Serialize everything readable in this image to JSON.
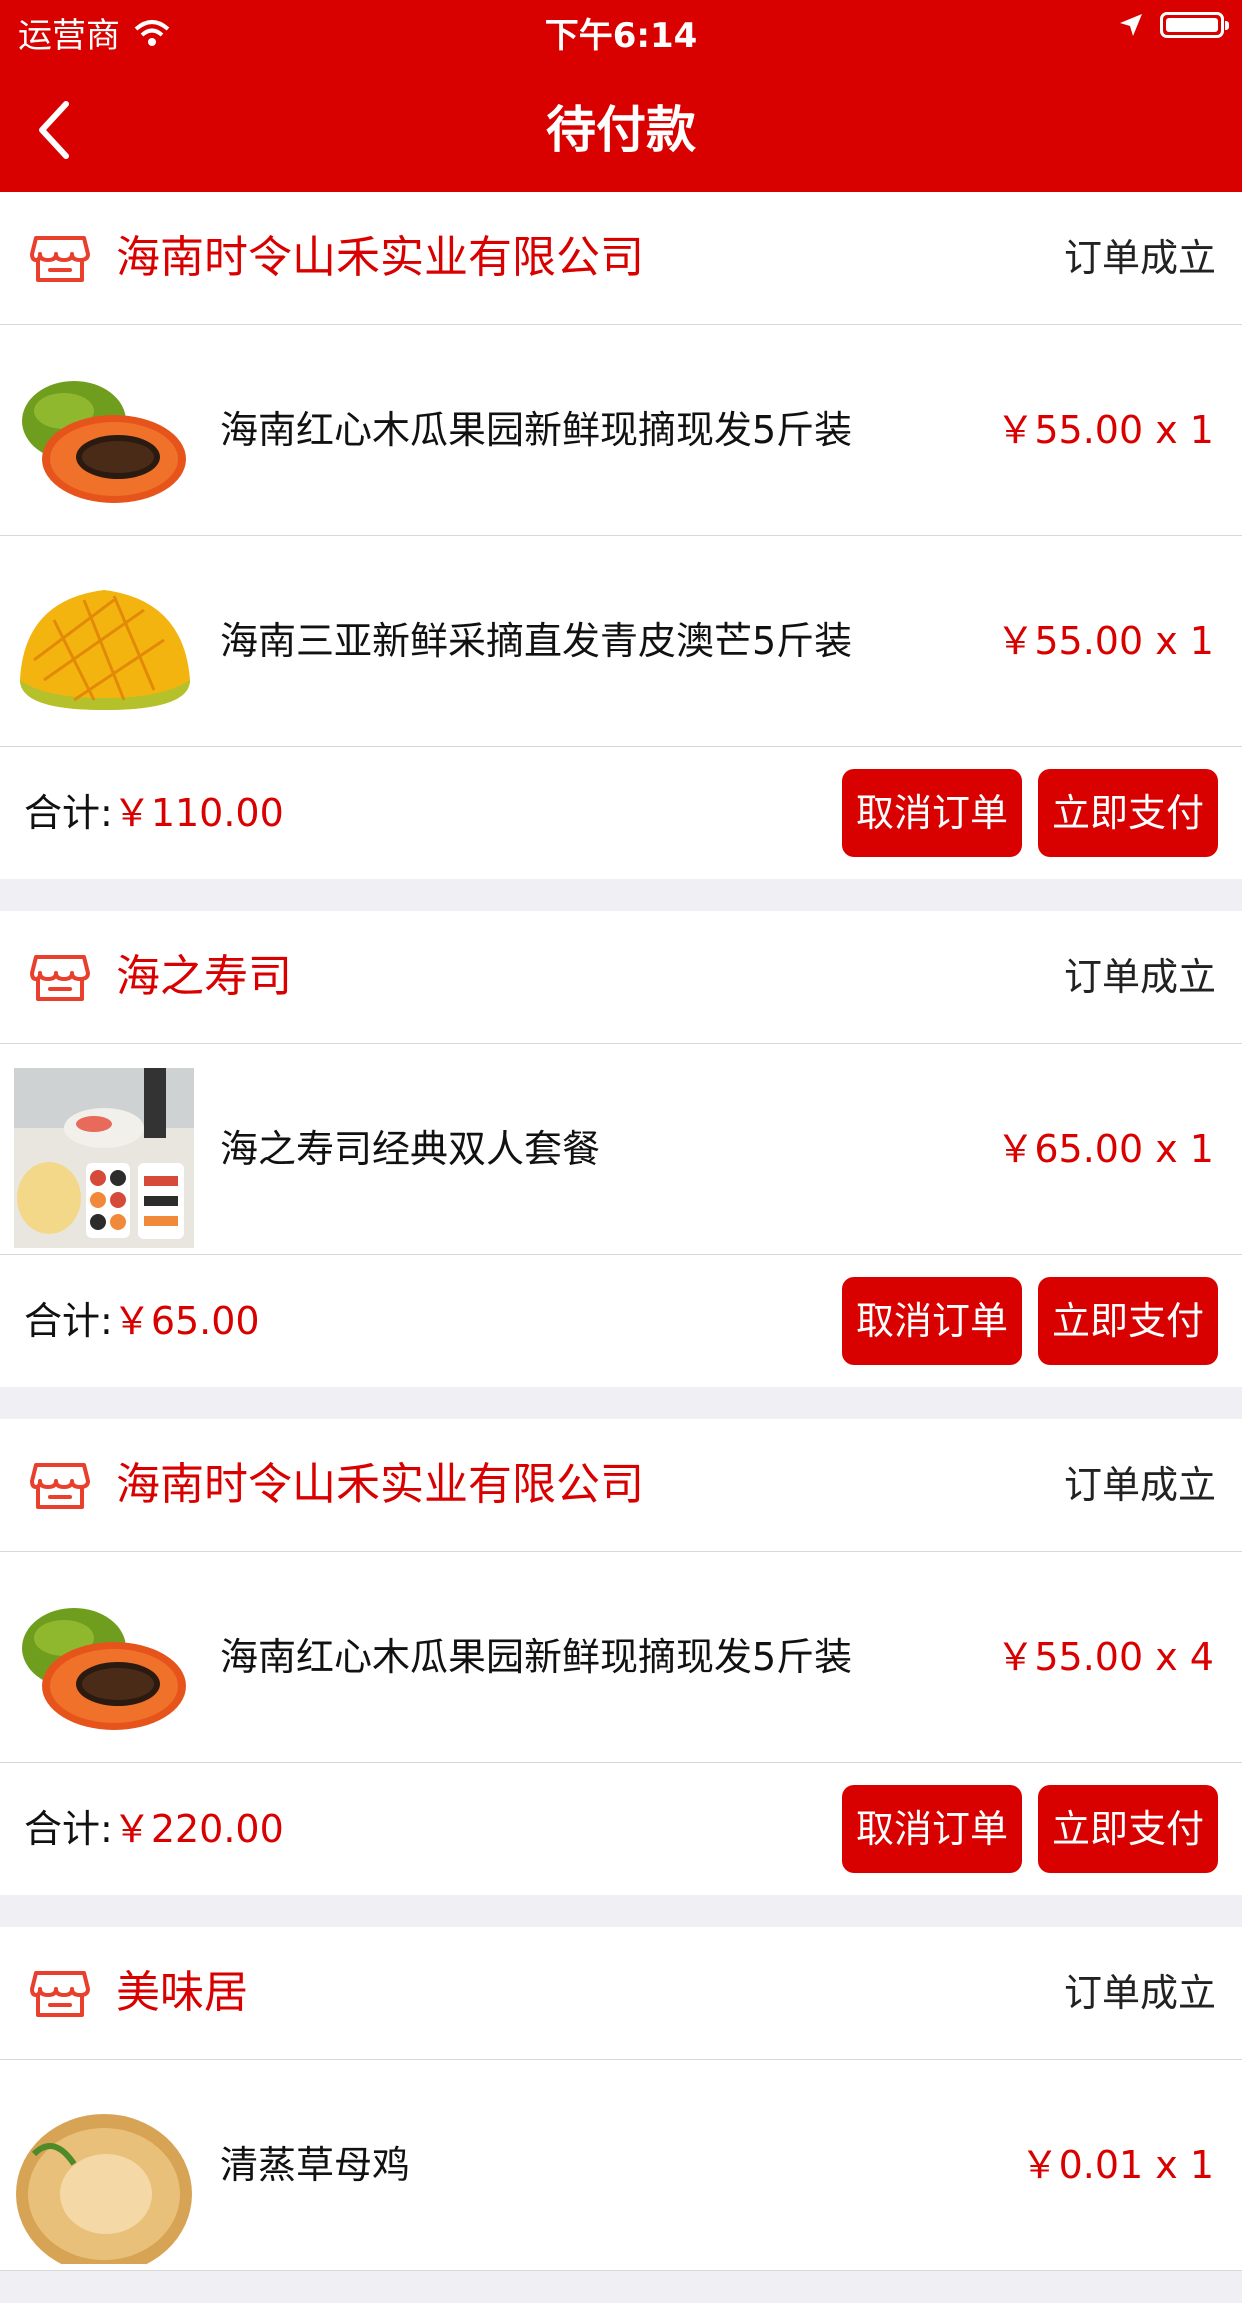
{
  "status_bar": {
    "carrier": "运营商",
    "time": "下午6:14"
  },
  "nav": {
    "title": "待付款",
    "back_icon": "chevron-left-icon"
  },
  "colors": {
    "brand": "#d90000",
    "background": "#efeff4"
  },
  "labels": {
    "total": "合计:",
    "cancel": "取消订单",
    "pay": "立即支付"
  },
  "orders": [
    {
      "store": "海南时令山禾实业有限公司",
      "status": "订单成立",
      "items": [
        {
          "name": "海南红心木瓜果园新鲜现摘现发5斤装",
          "price": "￥55.00 x 1",
          "image": "papaya"
        },
        {
          "name": "海南三亚新鲜采摘直发青皮澳芒5斤装",
          "price": "￥55.00 x 1",
          "image": "mango"
        }
      ],
      "total": "￥110.00"
    },
    {
      "store": "海之寿司",
      "status": "订单成立",
      "items": [
        {
          "name": "海之寿司经典双人套餐",
          "price": "￥65.00 x 1",
          "image": "sushi"
        }
      ],
      "total": "￥65.00"
    },
    {
      "store": "海南时令山禾实业有限公司",
      "status": "订单成立",
      "items": [
        {
          "name": "海南红心木瓜果园新鲜现摘现发5斤装",
          "price": "￥55.00 x 4",
          "image": "papaya"
        }
      ],
      "total": "￥220.00"
    },
    {
      "store": "美味居",
      "status": "订单成立",
      "items": [
        {
          "name": "清蒸草母鸡",
          "price": "￥0.01 x 1",
          "image": "chicken"
        }
      ]
    }
  ]
}
